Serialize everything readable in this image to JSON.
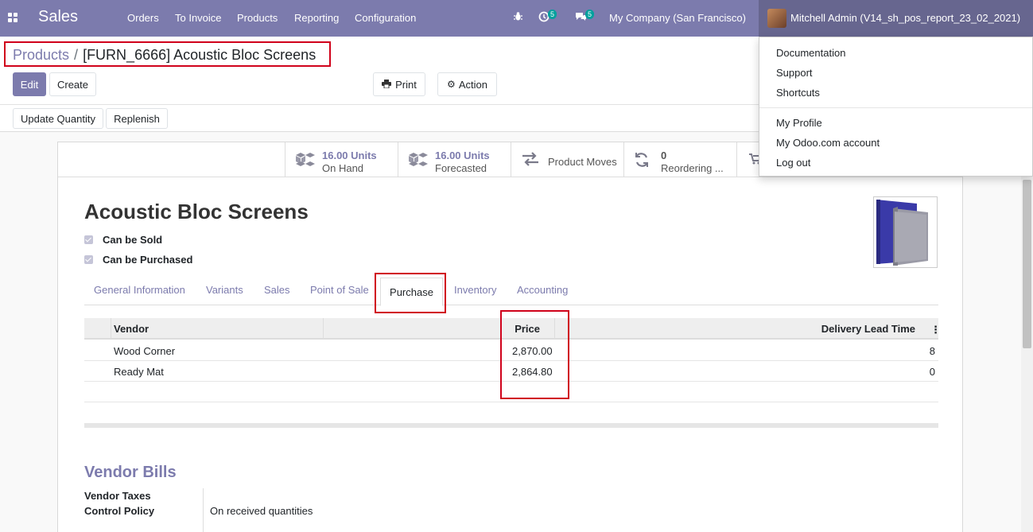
{
  "navbar": {
    "app_name": "Sales",
    "menu": [
      "Orders",
      "To Invoice",
      "Products",
      "Reporting",
      "Configuration"
    ],
    "activity_count": "5",
    "message_count": "5",
    "company": "My Company (San Francisco)",
    "user": "Mitchell Admin (V14_sh_pos_report_23_02_2021)"
  },
  "breadcrumb": {
    "parent": "Products",
    "separator": "/",
    "current": "[FURN_6666] Acoustic Bloc Screens"
  },
  "buttons": {
    "edit": "Edit",
    "create": "Create",
    "print": "Print",
    "action": "Action",
    "update_quantity": "Update Quantity",
    "replenish": "Replenish"
  },
  "smart_buttons": {
    "on_hand_value": "16.00 Units",
    "on_hand_label": "On Hand",
    "forecast_value": "16.00 Units",
    "forecast_label": "Forecasted",
    "moves_label": "Product Moves",
    "reorder_value": "0",
    "reorder_label": "Reordering ..."
  },
  "product": {
    "name": "Acoustic Bloc Screens",
    "can_be_sold": "Can be Sold",
    "can_be_purchased": "Can be Purchased"
  },
  "tabs": [
    "General Information",
    "Variants",
    "Sales",
    "Point of Sale",
    "Purchase",
    "Inventory",
    "Accounting"
  ],
  "active_tab": "Purchase",
  "vendor_table": {
    "headers": [
      "Vendor",
      "Price",
      "Delivery Lead Time"
    ],
    "rows": [
      {
        "vendor": "Wood Corner",
        "price": "2,870.00",
        "lead_time": "8"
      },
      {
        "vendor": "Ready Mat",
        "price": "2,864.80",
        "lead_time": "0"
      }
    ]
  },
  "vendor_bills": {
    "title": "Vendor Bills",
    "taxes_label": "Vendor Taxes",
    "control_label": "Control Policy",
    "control_value": "On received quantities"
  },
  "user_menu": {
    "group1": [
      "Documentation",
      "Support",
      "Shortcuts"
    ],
    "group2": [
      "My Profile",
      "My Odoo.com account",
      "Log out"
    ]
  },
  "colors": {
    "brand": "#7c7bad",
    "highlight": "#d0021b",
    "badge": "#00a09d"
  },
  "icons": [
    "apps-icon",
    "bug-icon",
    "activity-icon",
    "chat-icon",
    "print-icon",
    "gear-icon",
    "cubes-icon",
    "exchange-icon",
    "refresh-icon",
    "cart-icon",
    "kebab-icon"
  ]
}
